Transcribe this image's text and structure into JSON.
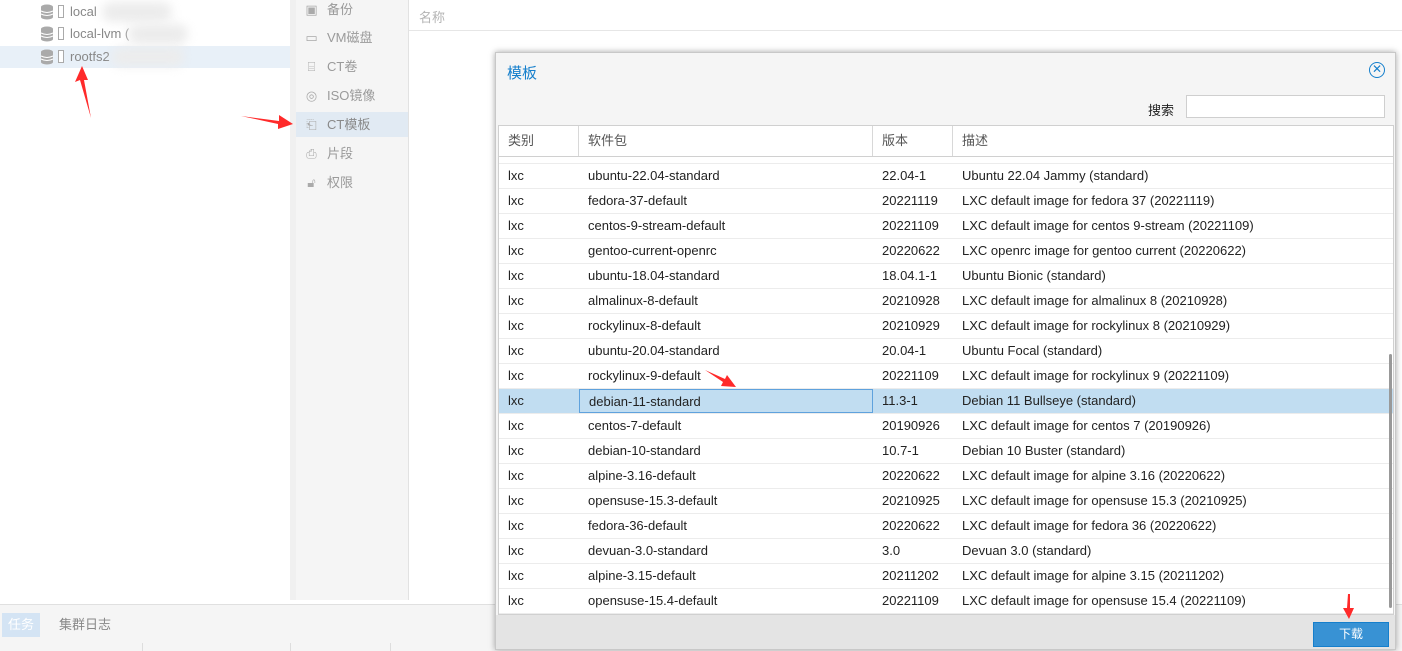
{
  "tree": {
    "items": [
      {
        "label": "local"
      },
      {
        "label": "local-lvm ("
      },
      {
        "label": "rootfs2"
      }
    ]
  },
  "menu": {
    "items": [
      {
        "label": "备份",
        "icon": "floppy-icon"
      },
      {
        "label": "VM磁盘",
        "icon": "hdd-icon"
      },
      {
        "label": "CT卷",
        "icon": "ct-volume-icon"
      },
      {
        "label": "ISO镜像",
        "icon": "disc-icon"
      },
      {
        "label": "CT模板",
        "icon": "template-icon"
      },
      {
        "label": "片段",
        "icon": "snippet-icon"
      },
      {
        "label": "权限",
        "icon": "unlock-icon"
      }
    ],
    "active": "CT模板"
  },
  "main": {
    "column_name": "名称"
  },
  "bottom": {
    "tabs": [
      {
        "label": "任务"
      },
      {
        "label": "集群日志"
      }
    ]
  },
  "dialog": {
    "title": "模板",
    "search_label": "搜索",
    "search_value": "",
    "columns": [
      "类别",
      "软件包",
      "版本",
      "描述"
    ],
    "partial_row": {
      "package": "",
      "description": ""
    },
    "rows": [
      {
        "type": "lxc",
        "package": "ubuntu-22.04-standard",
        "version": "22.04-1",
        "description": "Ubuntu 22.04 Jammy (standard)"
      },
      {
        "type": "lxc",
        "package": "fedora-37-default",
        "version": "20221119",
        "description": "LXC default image for fedora 37 (20221119)"
      },
      {
        "type": "lxc",
        "package": "centos-9-stream-default",
        "version": "20221109",
        "description": "LXC default image for centos 9-stream (20221109)"
      },
      {
        "type": "lxc",
        "package": "gentoo-current-openrc",
        "version": "20220622",
        "description": "LXC openrc image for gentoo current (20220622)"
      },
      {
        "type": "lxc",
        "package": "ubuntu-18.04-standard",
        "version": "18.04.1-1",
        "description": "Ubuntu Bionic (standard)"
      },
      {
        "type": "lxc",
        "package": "almalinux-8-default",
        "version": "20210928",
        "description": "LXC default image for almalinux 8 (20210928)"
      },
      {
        "type": "lxc",
        "package": "rockylinux-8-default",
        "version": "20210929",
        "description": "LXC default image for rockylinux 8 (20210929)"
      },
      {
        "type": "lxc",
        "package": "ubuntu-20.04-standard",
        "version": "20.04-1",
        "description": "Ubuntu Focal (standard)"
      },
      {
        "type": "lxc",
        "package": "rockylinux-9-default",
        "version": "20221109",
        "description": "LXC default image for rockylinux 9 (20221109)"
      },
      {
        "type": "lxc",
        "package": "debian-11-standard",
        "version": "11.3-1",
        "description": "Debian 11 Bullseye (standard)"
      },
      {
        "type": "lxc",
        "package": "centos-7-default",
        "version": "20190926",
        "description": "LXC default image for centos 7 (20190926)"
      },
      {
        "type": "lxc",
        "package": "debian-10-standard",
        "version": "10.7-1",
        "description": "Debian 10 Buster (standard)"
      },
      {
        "type": "lxc",
        "package": "alpine-3.16-default",
        "version": "20220622",
        "description": "LXC default image for alpine 3.16 (20220622)"
      },
      {
        "type": "lxc",
        "package": "opensuse-15.3-default",
        "version": "20210925",
        "description": "LXC default image for opensuse 15.3 (20210925)"
      },
      {
        "type": "lxc",
        "package": "fedora-36-default",
        "version": "20220622",
        "description": "LXC default image for fedora 36 (20220622)"
      },
      {
        "type": "lxc",
        "package": "devuan-3.0-standard",
        "version": "3.0",
        "description": "Devuan 3.0 (standard)"
      },
      {
        "type": "lxc",
        "package": "alpine-3.15-default",
        "version": "20211202",
        "description": "LXC default image for alpine 3.15 (20211202)"
      },
      {
        "type": "lxc",
        "package": "opensuse-15.4-default",
        "version": "20221109",
        "description": "LXC default image for opensuse 15.4 (20221109)"
      }
    ],
    "selected_package": "debian-11-standard",
    "download_label": "下载"
  },
  "colors": {
    "accent": "#157fcc",
    "selection": "#c1ddf1",
    "annotation": "#ff2a2a",
    "button": "#3892d4"
  }
}
